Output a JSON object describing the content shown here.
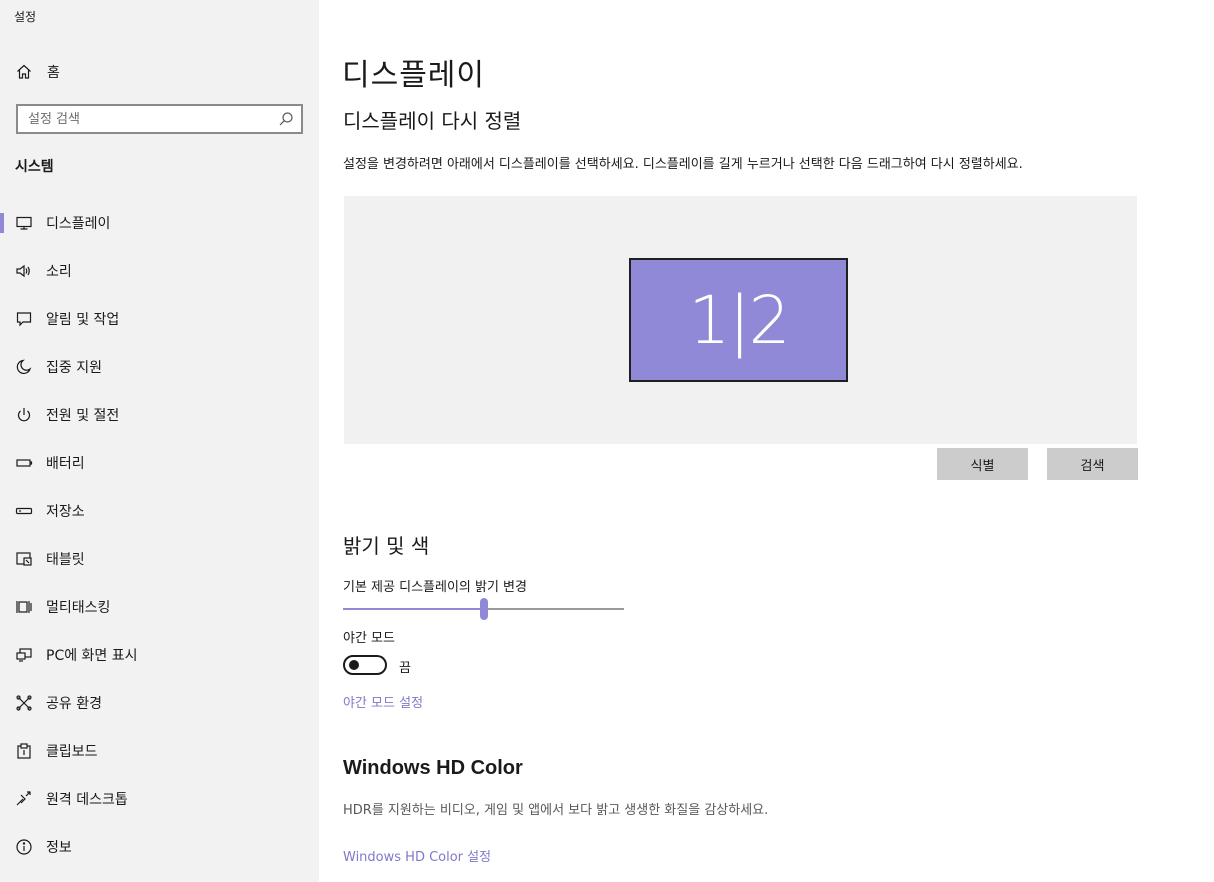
{
  "app": {
    "title": "설정"
  },
  "sidebar": {
    "home_label": "홈",
    "search_placeholder": "설정 검색",
    "section": "시스템",
    "items": [
      {
        "label": "디스플레이",
        "icon": "monitor-icon",
        "active": true
      },
      {
        "label": "소리",
        "icon": "speaker-icon"
      },
      {
        "label": "알림 및 작업",
        "icon": "notification-icon"
      },
      {
        "label": "집중 지원",
        "icon": "moon-icon"
      },
      {
        "label": "전원 및 절전",
        "icon": "power-icon"
      },
      {
        "label": "배터리",
        "icon": "battery-icon"
      },
      {
        "label": "저장소",
        "icon": "storage-icon"
      },
      {
        "label": "태블릿",
        "icon": "tablet-icon"
      },
      {
        "label": "멀티태스킹",
        "icon": "multitasking-icon"
      },
      {
        "label": "PC에 화면 표시",
        "icon": "project-icon"
      },
      {
        "label": "공유 환경",
        "icon": "shared-experiences-icon"
      },
      {
        "label": "클립보드",
        "icon": "clipboard-icon"
      },
      {
        "label": "원격 데스크톱",
        "icon": "remote-desktop-icon"
      },
      {
        "label": "정보",
        "icon": "info-icon"
      }
    ]
  },
  "main": {
    "title": "디스플레이",
    "rearrange": {
      "heading": "디스플레이 다시 정렬",
      "description": "설정을 변경하려면 아래에서 디스플레이를 선택하세요. 디스플레이를 길게 누르거나 선택한 다음 드래그하여 다시 정렬하세요.",
      "monitor_label": "1|2",
      "identify_button": "식별",
      "detect_button": "검색"
    },
    "brightness": {
      "heading": "밝기 및 색",
      "slider_label": "기본 제공 디스플레이의 밝기 변경",
      "slider_value": 50,
      "night_mode_label": "야간 모드",
      "night_mode_state": "끔",
      "night_mode_settings_link": "야간 모드 설정"
    },
    "hdr": {
      "heading": "Windows HD Color",
      "description": "HDR를 지원하는 비디오, 게임 및 앱에서 보다 밝고 생생한 화질을 감상하세요.",
      "settings_link": "Windows HD Color 설정"
    }
  },
  "colors": {
    "accent": "#8f89d8",
    "sidebar_bg": "#f2f2f2",
    "link": "#7f7ac9"
  }
}
